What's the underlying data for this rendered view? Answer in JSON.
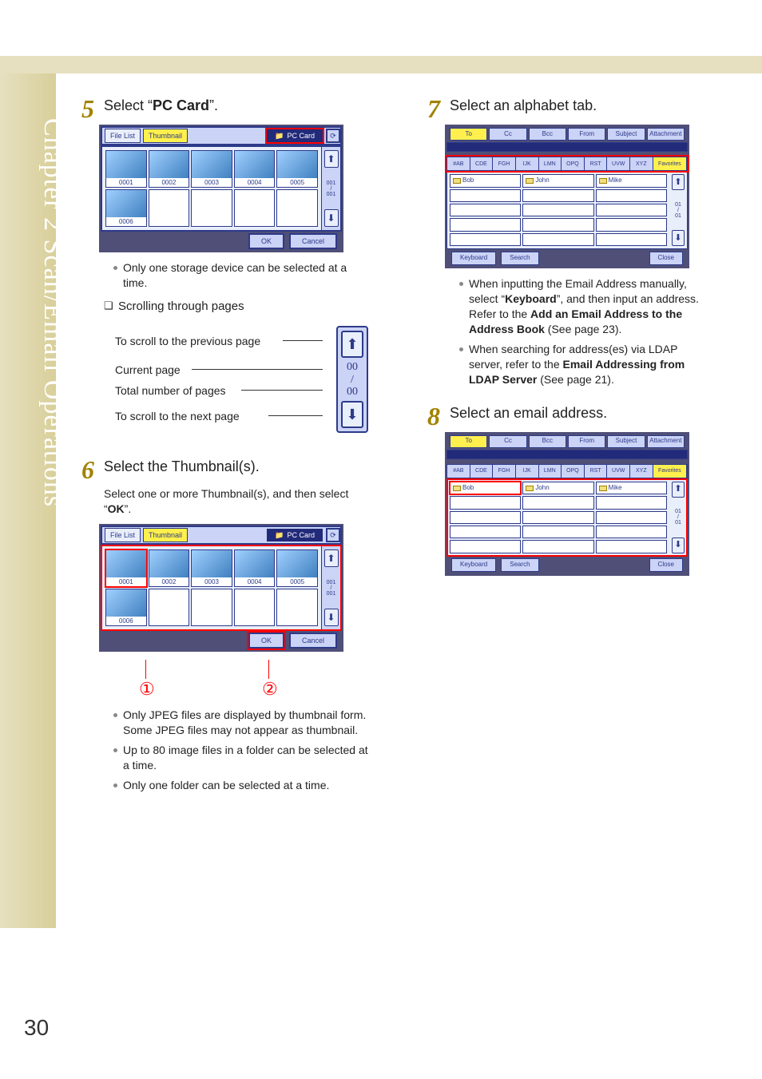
{
  "page_number": "30",
  "chapter_tab": "Chapter 2    Scan/Email Operations",
  "steps": {
    "s5": {
      "num": "5",
      "title_pre": "Select “",
      "title_bold": "PC Card",
      "title_post": "”.",
      "shot": {
        "file_list": "File List",
        "thumbnail": "Thumbnail",
        "pc_card": "PC Card",
        "cells": [
          "0001",
          "0002",
          "0003",
          "0004",
          "0005",
          "0006"
        ],
        "page_current": "001",
        "page_sep": "/",
        "page_total": "001",
        "ok": "OK",
        "cancel": "Cancel"
      },
      "bullets": [
        "Only one storage device can be selected at a time."
      ],
      "section": "Scrolling through pages",
      "legend": {
        "prev": "To scroll to the previous page",
        "cur": "Current page",
        "tot": "Total number of pages",
        "next": "To scroll to the next page",
        "curval": "00",
        "sep": "/",
        "totval": "00"
      }
    },
    "s6": {
      "num": "6",
      "title": "Select the Thumbnail(s).",
      "sub_pre": "Select one or more Thumbnail(s), and then select “",
      "sub_bold": "OK",
      "sub_post": "”.",
      "marker1": "①",
      "marker2": "②",
      "bullets": [
        "Only JPEG files are displayed by thumbnail form. Some JPEG files may not appear as thumbnail.",
        "Up to 80 image files in a folder can be selected at a time.",
        "Only one folder can be selected at a time."
      ]
    },
    "s7": {
      "num": "7",
      "title": "Select an alphabet tab.",
      "shot": {
        "tabs": [
          "To",
          "Cc",
          "Bcc",
          "From",
          "Subject",
          "Attachment"
        ],
        "alpha": [
          "#AB",
          "CDE",
          "FGH",
          "IJK",
          "LMN",
          "OPQ",
          "RST",
          "UVW",
          "XYZ"
        ],
        "fav": "Favorites",
        "names": [
          "Bob",
          "John",
          "Mike"
        ],
        "page_current": "01",
        "page_sep": "/",
        "page_total": "01",
        "keyboard": "Keyboard",
        "search": "Search",
        "close": "Close"
      },
      "b1_pre": "When inputting the Email Address manually, select “",
      "b1_bold": "Keyboard",
      "b1_mid": "”, and then input an address. Refer to the ",
      "b1_bold2": "Add an Email Address to the Address Book",
      "b1_post": " (See page 23).",
      "b2_pre": "When searching for address(es) via LDAP server, refer to the ",
      "b2_bold": "Email Addressing from LDAP Server",
      "b2_post": " (See page 21)."
    },
    "s8": {
      "num": "8",
      "title": "Select an email address."
    }
  }
}
